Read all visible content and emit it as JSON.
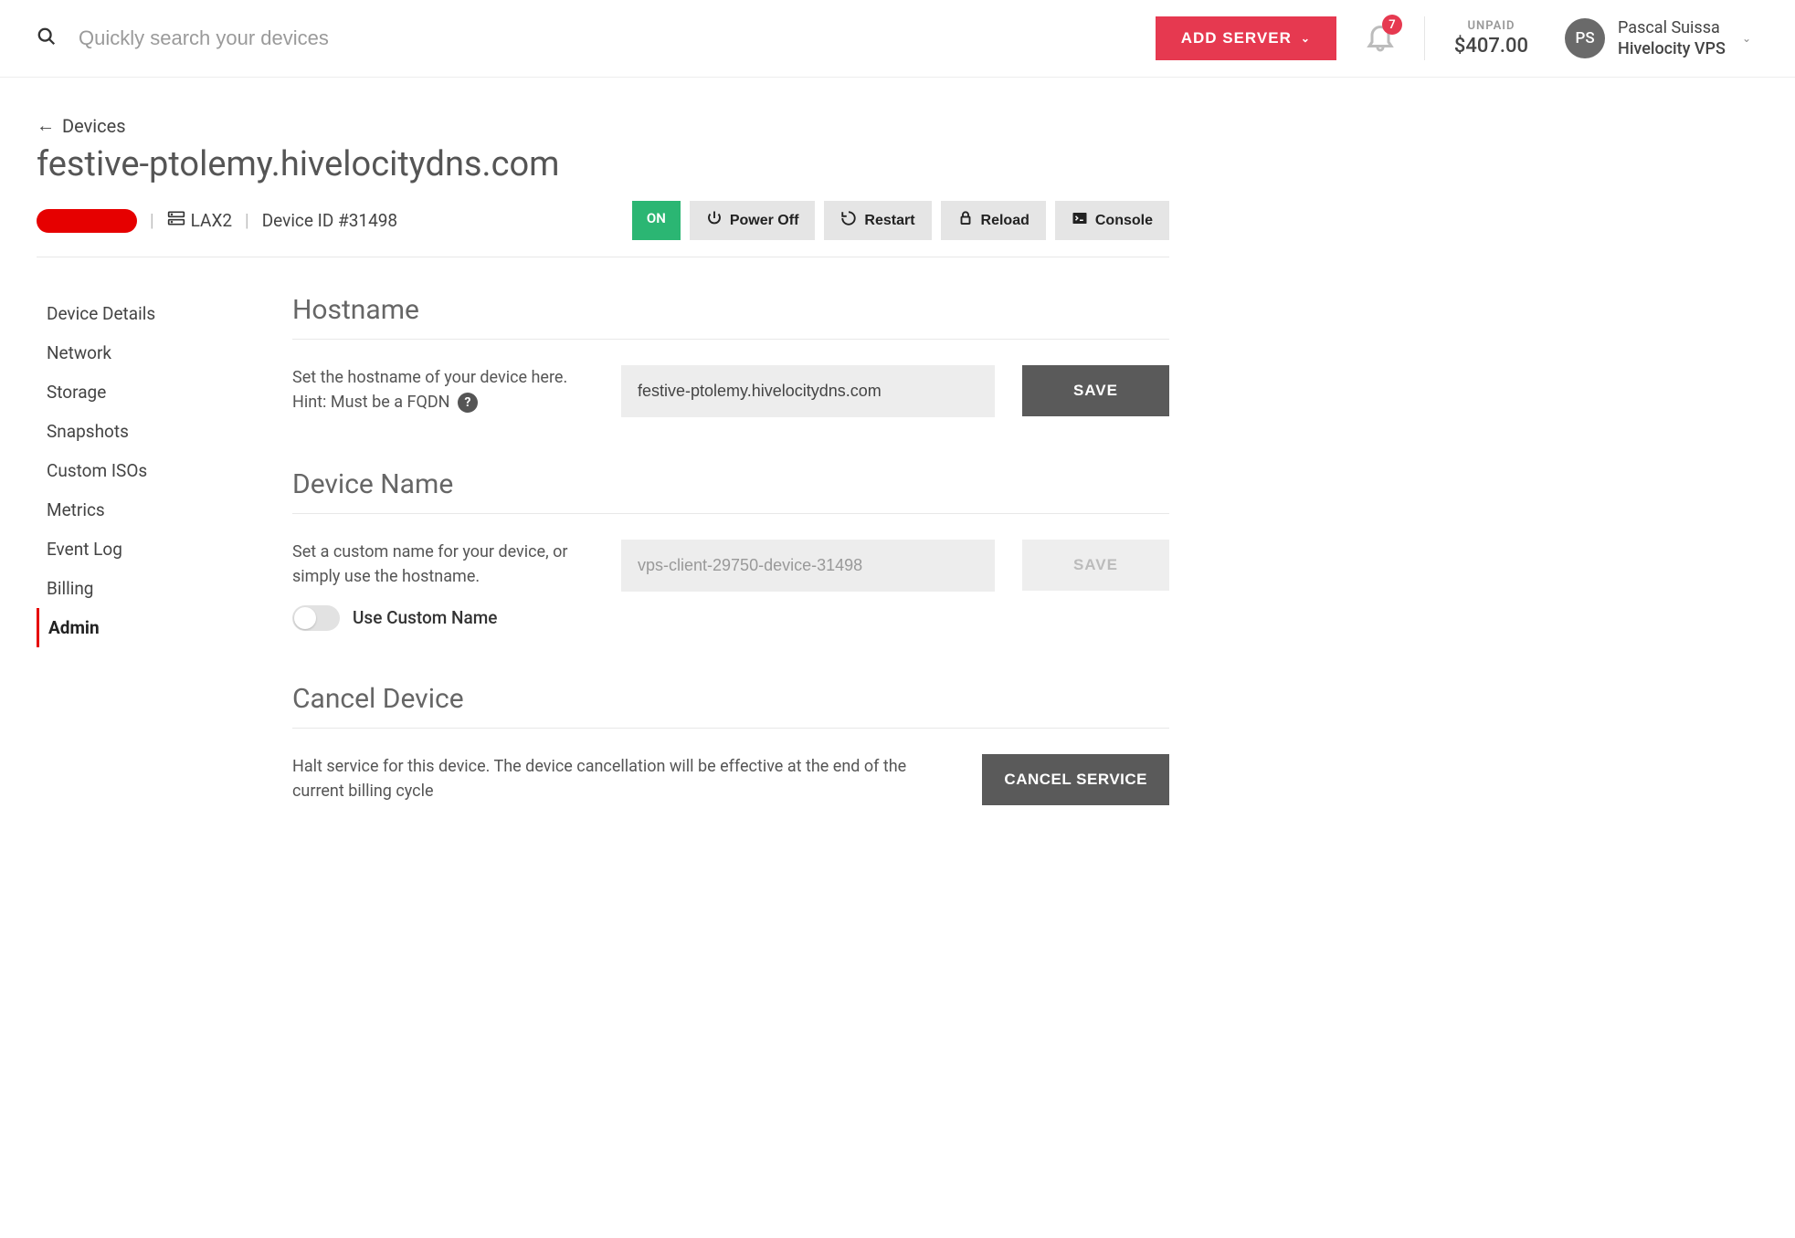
{
  "header": {
    "search_placeholder": "Quickly search your devices",
    "add_server_label": "ADD SERVER",
    "notification_count": "7",
    "unpaid_label": "UNPAID",
    "unpaid_amount": "$407.00",
    "avatar_initials": "PS",
    "user_name": "Pascal Suissa",
    "user_org": "Hivelocity VPS"
  },
  "breadcrumb": {
    "back_label": "Devices"
  },
  "device": {
    "title": "festive-ptolemy.hivelocitydns.com",
    "facility": "LAX2",
    "id_label": "Device ID #31498",
    "status": "ON",
    "actions": {
      "power_off": "Power Off",
      "restart": "Restart",
      "reload": "Reload",
      "console": "Console"
    }
  },
  "sidebar": {
    "items": [
      "Device Details",
      "Network",
      "Storage",
      "Snapshots",
      "Custom ISOs",
      "Metrics",
      "Event Log",
      "Billing",
      "Admin"
    ],
    "active_index": 8
  },
  "sections": {
    "hostname": {
      "title": "Hostname",
      "desc_line1": "Set the hostname of your device here.",
      "desc_line2": "Hint: Must be a FQDN",
      "value": "festive-ptolemy.hivelocitydns.com",
      "save_label": "SAVE"
    },
    "device_name": {
      "title": "Device Name",
      "desc": "Set a custom name for your device, or simply use the hostname.",
      "value": "vps-client-29750-device-31498",
      "save_label": "SAVE",
      "toggle_label": "Use Custom Name"
    },
    "cancel": {
      "title": "Cancel Device",
      "desc": "Halt service for this device. The device cancellation will be effective at the end of the current billing cycle",
      "button_label": "CANCEL SERVICE"
    }
  }
}
